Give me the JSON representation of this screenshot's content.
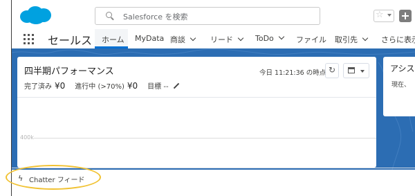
{
  "header": {
    "search": {
      "placeholder": "Salesforce を検索",
      "icon": "search-icon"
    },
    "brand_color": "#00a1e0",
    "icons": [
      "salesforce-cloud-icon",
      "star-icon",
      "chevron-down-icon",
      "plus-icon"
    ]
  },
  "nav": {
    "app_name": "セールス",
    "tabs": [
      {
        "label": "ホーム",
        "active": true,
        "dropdown": false
      },
      {
        "label": "MyData",
        "active": false,
        "dropdown": false
      },
      {
        "label": "商談",
        "active": false,
        "dropdown": true
      },
      {
        "label": "リード",
        "active": false,
        "dropdown": true
      },
      {
        "label": "ToDo",
        "active": false,
        "dropdown": true
      },
      {
        "label": "ファイル",
        "active": false,
        "dropdown": false
      },
      {
        "label": "取引先",
        "active": false,
        "dropdown": true
      },
      {
        "label": "さらに表示",
        "active": false,
        "dropdown": false
      }
    ],
    "active_color": "#0070d2"
  },
  "performance": {
    "title": "四半期パフォーマンス",
    "completed_label": "完了済み",
    "completed_value": "¥0",
    "in_progress_label": "進行中 (>70%)",
    "in_progress_value": "¥0",
    "goal_label": "目標",
    "goal_value": "--",
    "as_of": "今日 11:21:36 の時点",
    "axis_label": "400k"
  },
  "assistant": {
    "title": "アシス",
    "subtitle": "現在、"
  },
  "chatter": {
    "label": "Chatter フィード",
    "highlight_color": "#f1c232"
  },
  "band_color": "#2c6db3"
}
